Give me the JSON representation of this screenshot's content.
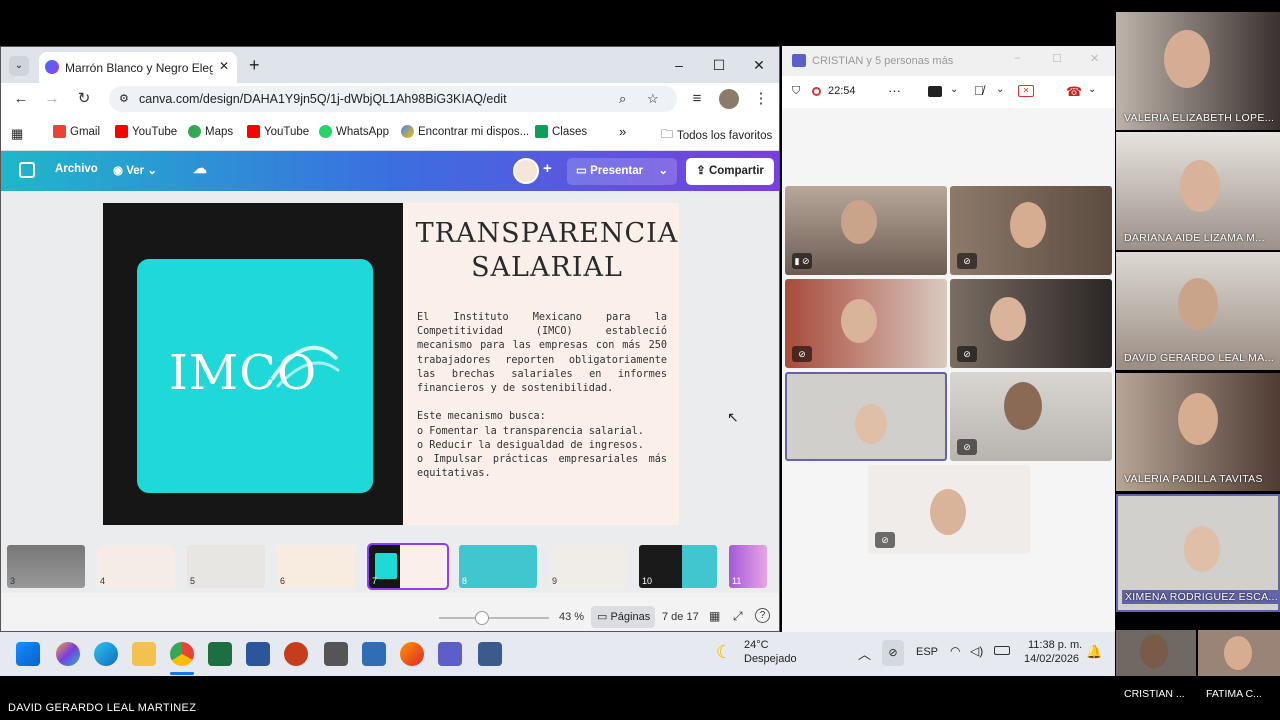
{
  "browser": {
    "tab_title": "Marrón Blanco y Negro Elegant",
    "url": "canva.com/design/DAHA1Y9jn5Q/1j-dWbjQL1Ah98BiG3KIAQ/edit",
    "bookmarks": [
      "Gmail",
      "YouTube",
      "Maps",
      "YouTube",
      "WhatsApp",
      "Encontrar mi dispos...",
      "Clases"
    ],
    "all_bookmarks": "Todos los favoritos"
  },
  "canva": {
    "archivo": "Archivo",
    "ver": "Ver",
    "presentar": "Presentar",
    "compartir": "Compartir",
    "zoom": "43 %",
    "paginas": "Páginas",
    "page_count": "7 de 17"
  },
  "slide": {
    "logo_text": "IMCO",
    "title_line1": "TRANSPARENCIA",
    "title_line2": "SALARIAL",
    "body": "El Instituto Mexicano para la Competitividad (IMCO) estableció mecanismo para las empresas con más 250 trabajadores reporten obligatoriamente las brechas salariales en informes financieros y de sostenibilidad.\n\nEste mecanismo busca:\no Fomentar la transparencia salarial.\no Reducir la desigualdad de ingresos.\no Impulsar prácticas empresariales más equitativas."
  },
  "thumbnails": [
    "3",
    "4",
    "5",
    "6",
    "7",
    "8",
    "9",
    "10",
    "11"
  ],
  "meeting": {
    "title": "CRISTIAN y 5 personas más",
    "time": "22:54"
  },
  "participants": [
    "VALERIA ELIZABETH LOPE...",
    "DARIANA AIDE LIZAMA M...",
    "DAVID GERARDO LEAL MA...",
    "VALERIA PADILLA TAVITAS",
    "XIMENA RODRIGUEZ ESCA..."
  ],
  "bottom_names": [
    "CRISTIAN ...",
    "FATIMA C..."
  ],
  "presenter": "DAVID GERARDO LEAL MARTINEZ",
  "taskbar": {
    "temp": "24°C",
    "weather": "Despejado",
    "lang": "ESP",
    "time": "11:38 p. m.",
    "date": "14/02/2026"
  }
}
